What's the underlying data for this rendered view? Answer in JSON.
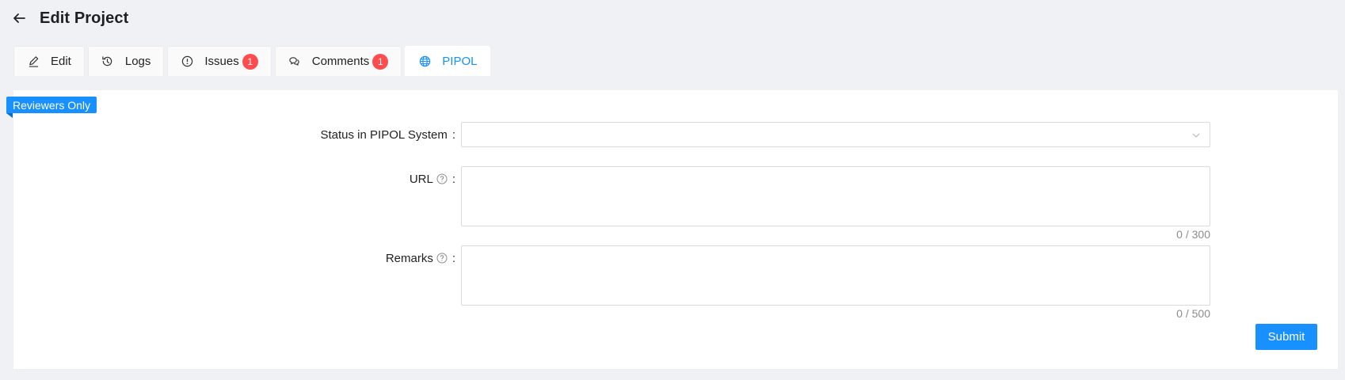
{
  "header": {
    "title": "Edit Project"
  },
  "tabs": [
    {
      "label": "Edit",
      "icon": "edit-icon"
    },
    {
      "label": "Logs",
      "icon": "history-icon"
    },
    {
      "label": "Issues",
      "icon": "alert-circle-icon",
      "badge": "1"
    },
    {
      "label": "Comments",
      "icon": "comments-icon",
      "badge": "1"
    },
    {
      "label": "PIPOL",
      "icon": "globe-icon",
      "active": true
    }
  ],
  "ribbon": {
    "label": "Reviewers Only"
  },
  "form": {
    "status_label": "Status in PIPOL System",
    "status_value": "",
    "url_label": "URL",
    "url_value": "",
    "url_counter": "0 / 300",
    "remarks_label": "Remarks",
    "remarks_value": "",
    "remarks_counter": "0 / 500",
    "colon": ":"
  },
  "actions": {
    "submit_label": "Submit"
  },
  "colors": {
    "accent": "#1890ff",
    "badge": "#ff4d4f",
    "background": "#f0f1f5"
  }
}
